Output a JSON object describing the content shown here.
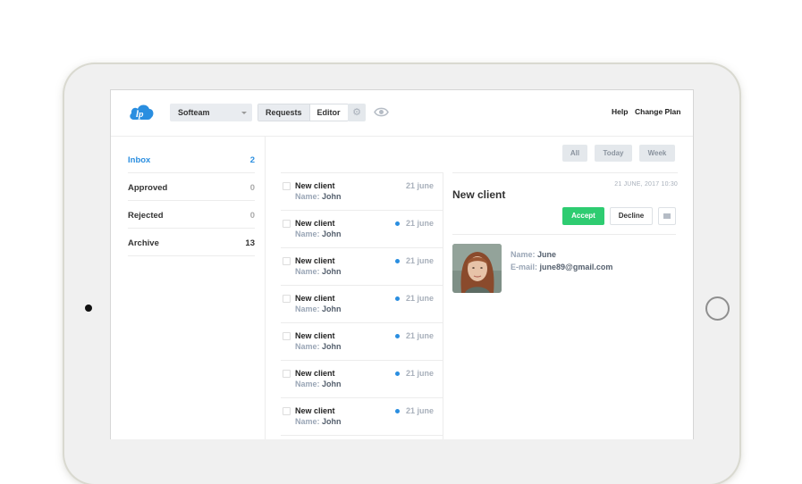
{
  "header": {
    "workspace": "Softeam",
    "tabs": [
      "Requests",
      "Editor"
    ],
    "links": [
      "Help",
      "Change Plan"
    ]
  },
  "sidebar": {
    "items": [
      {
        "label": "Inbox",
        "count": "2"
      },
      {
        "label": "Approved",
        "count": "0"
      },
      {
        "label": "Rejected",
        "count": "0"
      },
      {
        "label": "Archive",
        "count": "13"
      }
    ]
  },
  "filters": [
    "All",
    "Today",
    "Week"
  ],
  "list": {
    "name_prefix": "Name:",
    "rows": [
      {
        "title": "New client",
        "name": "John",
        "date": "21 june",
        "unread": false
      },
      {
        "title": "New client",
        "name": "John",
        "date": "21 june",
        "unread": true
      },
      {
        "title": "New client",
        "name": "John",
        "date": "21 june",
        "unread": true
      },
      {
        "title": "New client",
        "name": "John",
        "date": "21 june",
        "unread": true
      },
      {
        "title": "New client",
        "name": "John",
        "date": "21 june",
        "unread": true
      },
      {
        "title": "New client",
        "name": "John",
        "date": "21 june",
        "unread": true
      },
      {
        "title": "New client",
        "name": "John",
        "date": "21 june",
        "unread": true
      }
    ]
  },
  "detail": {
    "title": "New client",
    "datetime": "21 JUNE, 2017 10:30",
    "accept_label": "Accept",
    "decline_label": "Decline",
    "name_label": "Name:",
    "name_value": "June",
    "email_label": "E-mail:",
    "email_value": "june89@gmail.com"
  },
  "colors": {
    "accent": "#2a8ee0",
    "accept": "#2ecc71"
  }
}
